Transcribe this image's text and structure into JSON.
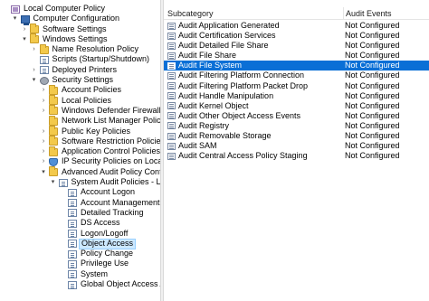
{
  "tree": [
    {
      "label": "Local Computer Policy",
      "depth": 0,
      "expander": "",
      "icon": "policy",
      "name": "tree-item-local-computer-policy"
    },
    {
      "label": "Computer Configuration",
      "depth": 1,
      "expander": "▾",
      "icon": "computer",
      "name": "tree-item-computer-configuration"
    },
    {
      "label": "Software Settings",
      "depth": 2,
      "expander": "›",
      "icon": "folder",
      "name": "tree-item-software-settings"
    },
    {
      "label": "Windows Settings",
      "depth": 2,
      "expander": "▾",
      "icon": "folder",
      "name": "tree-item-windows-settings"
    },
    {
      "label": "Name Resolution Policy",
      "depth": 3,
      "expander": "›",
      "icon": "folder",
      "name": "tree-item-name-resolution-policy"
    },
    {
      "label": "Scripts (Startup/Shutdown)",
      "depth": 3,
      "expander": "",
      "icon": "doc",
      "name": "tree-item-scripts"
    },
    {
      "label": "Deployed Printers",
      "depth": 3,
      "expander": "›",
      "icon": "doc",
      "name": "tree-item-deployed-printers"
    },
    {
      "label": "Security Settings",
      "depth": 3,
      "expander": "▾",
      "icon": "gear",
      "name": "tree-item-security-settings"
    },
    {
      "label": "Account Policies",
      "depth": 4,
      "expander": "›",
      "icon": "folder",
      "name": "tree-item-account-policies"
    },
    {
      "label": "Local Policies",
      "depth": 4,
      "expander": "›",
      "icon": "folder",
      "name": "tree-item-local-policies"
    },
    {
      "label": "Windows Defender Firewall wi",
      "depth": 4,
      "expander": "›",
      "icon": "folder",
      "name": "tree-item-windows-defender-firewall"
    },
    {
      "label": "Network List Manager Policies",
      "depth": 4,
      "expander": "",
      "icon": "folder",
      "name": "tree-item-network-list-manager"
    },
    {
      "label": "Public Key Policies",
      "depth": 4,
      "expander": "›",
      "icon": "folder",
      "name": "tree-item-public-key-policies"
    },
    {
      "label": "Software Restriction Policies",
      "depth": 4,
      "expander": "›",
      "icon": "folder",
      "name": "tree-item-software-restriction"
    },
    {
      "label": "Application Control Policies",
      "depth": 4,
      "expander": "›",
      "icon": "folder",
      "name": "tree-item-application-control"
    },
    {
      "label": "IP Security Policies on Local C",
      "depth": 4,
      "expander": "›",
      "icon": "shield",
      "name": "tree-item-ip-security-policies"
    },
    {
      "label": "Advanced Audit Policy Configu",
      "depth": 4,
      "expander": "▾",
      "icon": "folder",
      "name": "tree-item-advanced-audit-policy"
    },
    {
      "label": "System Audit Policies - Loc",
      "depth": 5,
      "expander": "▾",
      "icon": "doc",
      "name": "tree-item-system-audit-policies"
    },
    {
      "label": "Account Logon",
      "depth": 6,
      "expander": "",
      "icon": "doc",
      "name": "tree-item-account-logon"
    },
    {
      "label": "Account Management",
      "depth": 6,
      "expander": "",
      "icon": "doc",
      "name": "tree-item-account-management"
    },
    {
      "label": "Detailed Tracking",
      "depth": 6,
      "expander": "",
      "icon": "doc",
      "name": "tree-item-detailed-tracking"
    },
    {
      "label": "DS Access",
      "depth": 6,
      "expander": "",
      "icon": "doc",
      "name": "tree-item-ds-access"
    },
    {
      "label": "Logon/Logoff",
      "depth": 6,
      "expander": "",
      "icon": "doc",
      "name": "tree-item-logon-logoff"
    },
    {
      "label": "Object Access",
      "depth": 6,
      "expander": "",
      "icon": "doc",
      "name": "tree-item-object-access",
      "selected": true
    },
    {
      "label": "Policy Change",
      "depth": 6,
      "expander": "",
      "icon": "doc",
      "name": "tree-item-policy-change"
    },
    {
      "label": "Privilege Use",
      "depth": 6,
      "expander": "",
      "icon": "doc",
      "name": "tree-item-privilege-use"
    },
    {
      "label": "System",
      "depth": 6,
      "expander": "",
      "icon": "doc",
      "name": "tree-item-system"
    },
    {
      "label": "Global Object Access A",
      "depth": 6,
      "expander": "",
      "icon": "doc",
      "name": "tree-item-global-object-access"
    }
  ],
  "list": {
    "columns": {
      "subcategory": "Subcategory",
      "audit_events": "Audit Events"
    },
    "rows": [
      {
        "subcategory": "Audit Application Generated",
        "audit_events": "Not Configured"
      },
      {
        "subcategory": "Audit Certification Services",
        "audit_events": "Not Configured"
      },
      {
        "subcategory": "Audit Detailed File Share",
        "audit_events": "Not Configured"
      },
      {
        "subcategory": "Audit File Share",
        "audit_events": "Not Configured"
      },
      {
        "subcategory": "Audit File System",
        "audit_events": "Not Configured",
        "selected": true
      },
      {
        "subcategory": "Audit Filtering Platform Connection",
        "audit_events": "Not Configured"
      },
      {
        "subcategory": "Audit Filtering Platform Packet Drop",
        "audit_events": "Not Configured"
      },
      {
        "subcategory": "Audit Handle Manipulation",
        "audit_events": "Not Configured"
      },
      {
        "subcategory": "Audit Kernel Object",
        "audit_events": "Not Configured"
      },
      {
        "subcategory": "Audit Other Object Access Events",
        "audit_events": "Not Configured"
      },
      {
        "subcategory": "Audit Registry",
        "audit_events": "Not Configured"
      },
      {
        "subcategory": "Audit Removable Storage",
        "audit_events": "Not Configured"
      },
      {
        "subcategory": "Audit SAM",
        "audit_events": "Not Configured"
      },
      {
        "subcategory": "Audit Central Access Policy Staging",
        "audit_events": "Not Configured"
      }
    ]
  },
  "colors": {
    "selection": "#0a6fd6",
    "tree_selection": "#cce8ff"
  }
}
